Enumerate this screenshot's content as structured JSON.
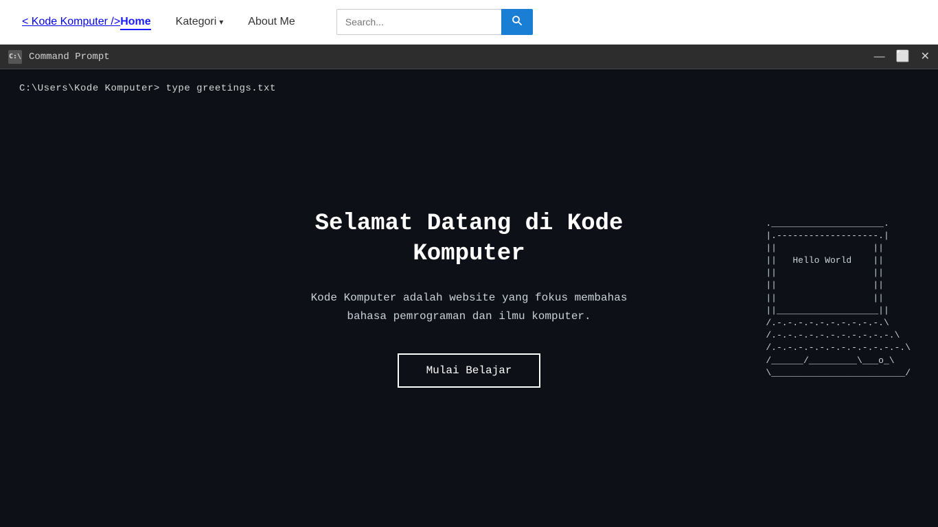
{
  "nav": {
    "logo_prefix": "< ",
    "logo_brand": "Kode Komputer",
    "logo_suffix": " />",
    "links": [
      {
        "label": "Home",
        "active": true
      },
      {
        "label": "Kategori",
        "has_dropdown": true
      },
      {
        "label": "About Me",
        "active": false
      }
    ],
    "search_placeholder": "Search..."
  },
  "cmd_window": {
    "title": "Command Prompt",
    "icon_label": "C:\\",
    "prompt_line": "C:\\Users\\Kode Komputer> type greetings.txt",
    "controls": {
      "minimize": "—",
      "maximize": "⬜",
      "close": "✕"
    }
  },
  "hero": {
    "title": "Selamat Datang di Kode Komputer",
    "description": "Kode Komputer adalah website yang fokus membahas bahasa pemrograman dan ilmu\nkomputer.",
    "button_label": "Mulai Belajar"
  },
  "ascii_art": "  ._____________________.\n  |.-------------------.|  \n  ||                  ||\n  ||   Hello World    ||\n  ||                  ||\n  ||                  ||\n  ||                  ||\n  ||___________________||\n  /.-.-.-.-.-.-.-.-.-.-.\\\n /.-.-.-.-.-.-.-.-.-.-.-.\\  \n/.-.-.-.-.-.-.-.-.-.-.-.-.\\\n/______/_________\\___o_\\\n\\_________________________/"
}
